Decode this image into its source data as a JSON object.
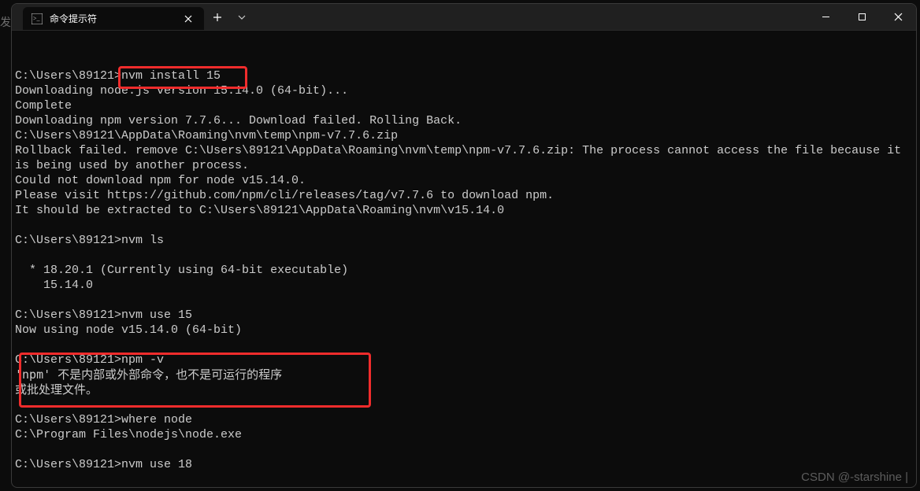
{
  "outside_glyph": "发",
  "titlebar": {
    "tab_title": "命令提示符",
    "new_tab_tooltip": "+",
    "dropdown_tooltip": "v"
  },
  "terminal": {
    "lines": [
      "",
      "",
      "C:\\Users\\89121>nvm install 15",
      "Downloading node.js version 15.14.0 (64-bit)...",
      "Complete",
      "Downloading npm version 7.7.6... Download failed. Rolling Back.",
      "C:\\Users\\89121\\AppData\\Roaming\\nvm\\temp\\npm-v7.7.6.zip",
      "Rollback failed. remove C:\\Users\\89121\\AppData\\Roaming\\nvm\\temp\\npm-v7.7.6.zip: The process cannot access the file because it is being used by another process.",
      "Could not download npm for node v15.14.0.",
      "Please visit https://github.com/npm/cli/releases/tag/v7.7.6 to download npm.",
      "It should be extracted to C:\\Users\\89121\\AppData\\Roaming\\nvm\\v15.14.0",
      "",
      "C:\\Users\\89121>nvm ls",
      "",
      "  * 18.20.1 (Currently using 64-bit executable)",
      "    15.14.0",
      "",
      "C:\\Users\\89121>nvm use 15",
      "Now using node v15.14.0 (64-bit)",
      "",
      "C:\\Users\\89121>npm -v",
      "'npm' 不是内部或外部命令，也不是可运行的程序",
      "或批处理文件。",
      "",
      "C:\\Users\\89121>where node",
      "C:\\Program Files\\nodejs\\node.exe",
      "",
      "C:\\Users\\89121>nvm use 18"
    ],
    "cn_line_indices": [
      21,
      22
    ]
  },
  "highlights": [
    {
      "name": "hl-install-15",
      "class": "hl1"
    },
    {
      "name": "hl-npm-error",
      "class": "hl2"
    }
  ],
  "watermark": "CSDN @-starshine |"
}
